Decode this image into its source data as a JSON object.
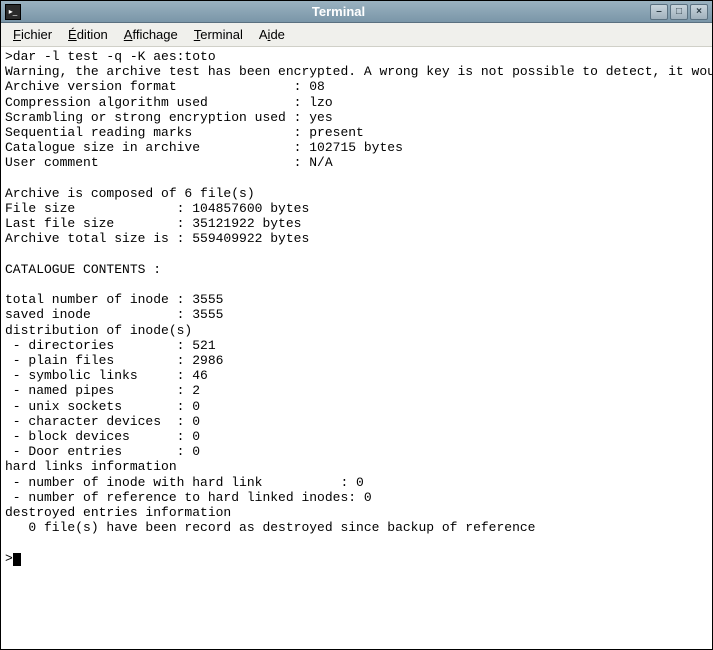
{
  "window": {
    "title": "Terminal"
  },
  "menubar": {
    "items": [
      {
        "pre": "",
        "hot": "F",
        "rest": "ichier"
      },
      {
        "pre": "",
        "hot": "É",
        "rest": "dition"
      },
      {
        "pre": "",
        "hot": "A",
        "rest": "ffichage"
      },
      {
        "pre": "",
        "hot": "T",
        "rest": "erminal"
      },
      {
        "pre": "A",
        "hot": "i",
        "rest": "de"
      }
    ]
  },
  "terminal": {
    "command": ">dar -l test -q -K aes:toto",
    "warning": "Warning, the archive test has been encrypted. A wrong key is not possible to detect, it would cause DAR to report the archive as corrupted",
    "archive_info": {
      "version_line": "Archive version format               : 08",
      "compression_line": "Compression algorithm used           : lzo",
      "scrambling_line": "Scrambling or strong encryption used : yes",
      "sequential_line": "Sequential reading marks             : present",
      "catalogue_line": "Catalogue size in archive            : 102715 bytes",
      "user_comment_line": "User comment                         : N/A"
    },
    "composition": {
      "count_line": "Archive is composed of 6 file(s)",
      "file_size_line": "File size             : 104857600 bytes",
      "last_size_line": "Last file size        : 35121922 bytes",
      "total_line": "Archive total size is : 559409922 bytes"
    },
    "catalogue_header": "CATALOGUE CONTENTS :",
    "inodes": {
      "total_line": "total number of inode : 3555",
      "saved_line": "saved inode           : 3555",
      "dist_header": "distribution of inode(s)",
      "dirs_line": " - directories        : 521",
      "plain_line": " - plain files        : 2986",
      "symlinks_line": " - symbolic links     : 46",
      "pipes_line": " - named pipes        : 2",
      "sockets_line": " - unix sockets       : 0",
      "chardev_line": " - character devices  : 0",
      "blockdev_line": " - block devices      : 0",
      "door_line": " - Door entries       : 0"
    },
    "hardlinks": {
      "header": "hard links information",
      "count_line": " - number of inode with hard link          : 0",
      "ref_line": " - number of reference to hard linked inodes: 0"
    },
    "destroyed": {
      "header": "destroyed entries information",
      "body": "   0 file(s) have been record as destroyed since backup of reference"
    },
    "prompt_end": ">"
  }
}
